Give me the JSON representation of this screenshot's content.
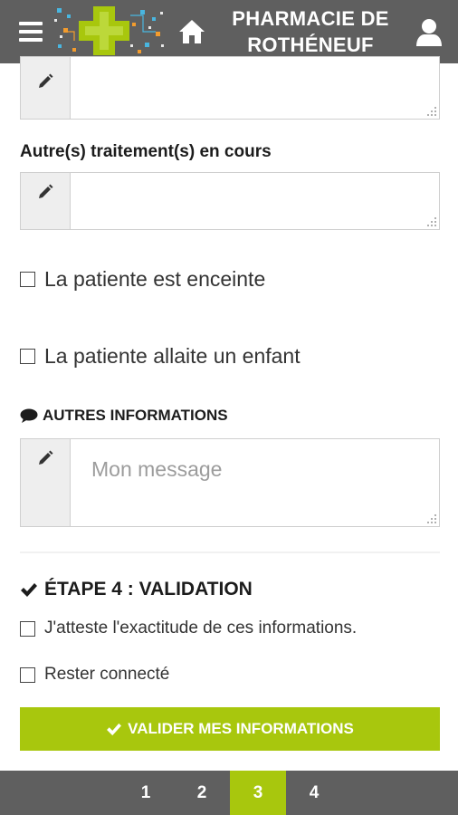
{
  "header": {
    "title_line1": "PHARMACIE DE",
    "title_line2": "ROTHÉNEUF",
    "menu_icon": "hamburger-menu-icon",
    "home_icon": "home-icon",
    "user_icon": "user-icon",
    "logo": "pharmacy-cross-logo"
  },
  "form": {
    "first_textarea": {
      "value": ""
    },
    "other_treatments": {
      "label": "Autre(s) traitement(s) en cours",
      "value": ""
    },
    "pregnant_checkbox": {
      "label": "La patiente est enceinte",
      "checked": false
    },
    "breastfeeding_checkbox": {
      "label": "La patiente allaite un enfant",
      "checked": false
    },
    "other_info": {
      "title": "AUTRES INFORMATIONS",
      "icon": "speech-bubble-icon",
      "placeholder": "Mon message",
      "value": ""
    }
  },
  "validation": {
    "title": "ÉTAPE 4 : VALIDATION",
    "icon": "checkmark-icon",
    "attest_checkbox": {
      "label": "J'atteste l'exactitude de ces informations.",
      "checked": false
    },
    "stay_connected_checkbox": {
      "label": "Rester connecté",
      "checked": false
    },
    "submit_label": "VALIDER MES INFORMATIONS"
  },
  "pagination": {
    "pages": [
      "1",
      "2",
      "3",
      "4"
    ],
    "current": "3"
  },
  "colors": {
    "header_bg": "#5f5f5f",
    "accent": "#a8c70d",
    "input_border": "#cfcfcf",
    "pencil_cell_bg": "#eeeeee"
  }
}
